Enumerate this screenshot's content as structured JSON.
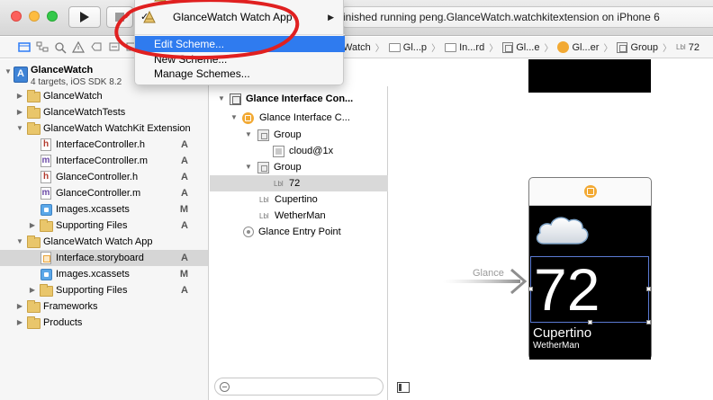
{
  "toolbar": {
    "status_text": "inished running peng.GlanceWatch.watchkitextension on iPhone 6"
  },
  "scheme_menu": {
    "app_item": "GlanceWatch Watch App",
    "items": [
      {
        "label": "Edit Scheme..."
      },
      {
        "label": "New Scheme..."
      },
      {
        "label": "Manage Schemes..."
      }
    ]
  },
  "jump_bar": {
    "items": [
      "Watch",
      "Gl...p",
      "In...rd",
      "Gl...e",
      "Gl...er",
      "Group",
      "72"
    ],
    "lbl_tag": "Lbl"
  },
  "navigator": {
    "project": {
      "name": "GlanceWatch",
      "subtitle": "4 targets, iOS SDK 8.2"
    },
    "rows": [
      {
        "label": "GlanceWatch",
        "status": ""
      },
      {
        "label": "GlanceWatchTests",
        "status": ""
      },
      {
        "label": "GlanceWatch WatchKit Extension",
        "status": ""
      },
      {
        "label": "InterfaceController.h",
        "status": "A"
      },
      {
        "label": "InterfaceController.m",
        "status": "A"
      },
      {
        "label": "GlanceController.h",
        "status": "A"
      },
      {
        "label": "GlanceController.m",
        "status": "A"
      },
      {
        "label": "Images.xcassets",
        "status": "M"
      },
      {
        "label": "Supporting Files",
        "status": "A"
      },
      {
        "label": "GlanceWatch Watch App",
        "status": ""
      },
      {
        "label": "Interface.storyboard",
        "status": "A"
      },
      {
        "label": "Images.xcassets",
        "status": "M"
      },
      {
        "label": "Supporting Files",
        "status": "A"
      },
      {
        "label": "Frameworks",
        "status": ""
      },
      {
        "label": "Products",
        "status": ""
      }
    ]
  },
  "outline": {
    "rows": [
      {
        "label": "Glance Interface Con..."
      },
      {
        "label": "Glance Interface C..."
      },
      {
        "label": "Group"
      },
      {
        "label": "cloud@1x"
      },
      {
        "label": "Group"
      },
      {
        "label": "72"
      },
      {
        "label": "Cupertino"
      },
      {
        "label": "WetherMan"
      },
      {
        "label": "Glance Entry Point"
      }
    ],
    "lbl_tag": "Lbl"
  },
  "canvas": {
    "entry_label": "Glance",
    "temperature": "72",
    "city": "Cupertino",
    "weather_man": "WetherMan"
  },
  "colors": {
    "selection_blue": "#2f7bef",
    "glance_orange": "#f2a933",
    "annotation_red": "#e02020"
  }
}
